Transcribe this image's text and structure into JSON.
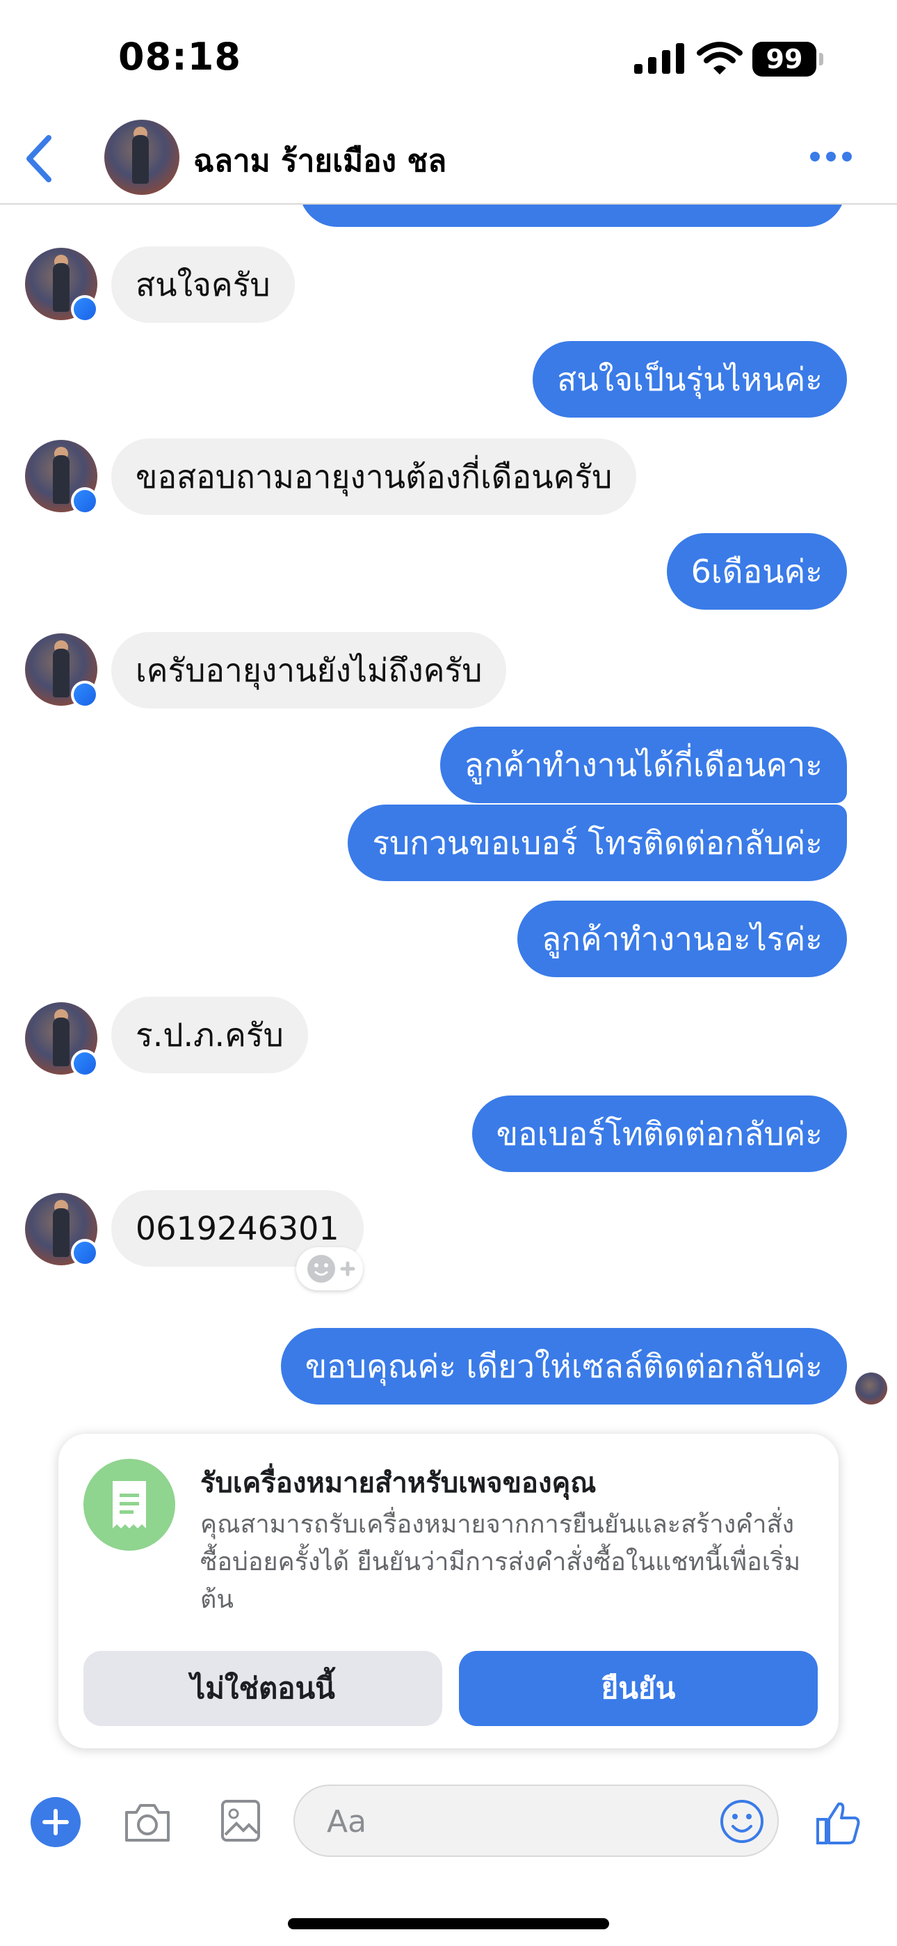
{
  "status_bar": {
    "time": "08:18",
    "battery": "99"
  },
  "header": {
    "contact_name": "ฉลาม ร้ายเมือง ชล"
  },
  "messages": {
    "m1": "สนใจครับ",
    "m2": "สนใจเป็นรุ่นไหนค่ะ",
    "m3": "ขอสอบถามอายุงานต้องกี่เดือนครับ",
    "m4": "6เดือนค่ะ",
    "m5": "เครับอายุงานยังไม่ถึงครับ",
    "m6": "ลูกค้าทำงานได้กี่เดือนคาะ",
    "m7": "รบกวนขอเบอร์ โทรติดต่อกลับค่ะ",
    "m8": "ลูกค้าทำงานอะไรค่ะ",
    "m9": "ร.ป.ภ.ครับ",
    "m10": "ขอเบอร์โทติดต่อกลับค่ะ",
    "m11": "0619246301",
    "m12": "ขอบคุณค่ะ เดียวให่เซลล์ติดต่อกลับค่ะ"
  },
  "card": {
    "title": "รับเครื่องหมายสำหรับเพจของคุณ",
    "description": "คุณสามารถรับเครื่องหมายจากการยืนยันและสร้างคำสั่งซื้อบ่อยครั้งได้ ยืนยันว่ามีการส่งคำสั่งซื้อในแชทนี้เพื่อเริ่มต้น",
    "not_now_label": "ไม่ใช่ตอนนี้",
    "confirm_label": "ยืนยัน"
  },
  "composer": {
    "placeholder": "Aa"
  },
  "colors": {
    "accent": "#3a7be8",
    "incoming_bubble": "#f0f0f0",
    "badge_green": "#8fd48f"
  }
}
